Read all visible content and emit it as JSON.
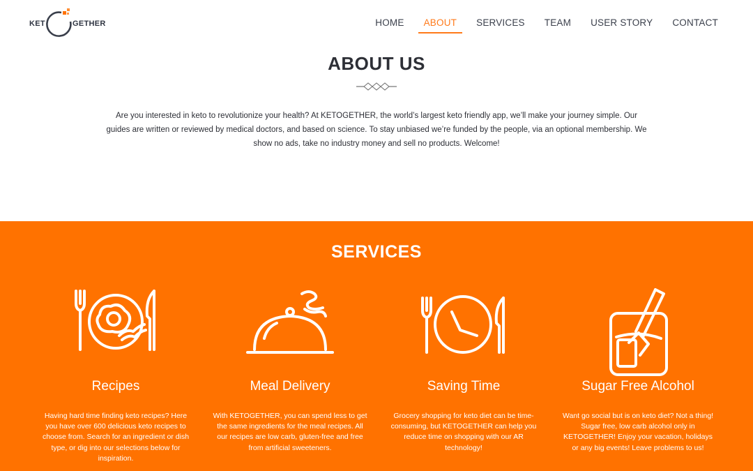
{
  "logo": {
    "left": "KET",
    "right": "GETHER"
  },
  "nav": {
    "items": [
      {
        "label": "HOME"
      },
      {
        "label": "ABOUT"
      },
      {
        "label": "SERVICES"
      },
      {
        "label": "TEAM"
      },
      {
        "label": "USER STORY"
      },
      {
        "label": "CONTACT"
      }
    ],
    "active": "ABOUT"
  },
  "about": {
    "title": "ABOUT US",
    "text": "Are you interested in keto to revolutionize your health? At KETOGETHER, the world’s largest keto friendly app, we’ll make your journey simple. Our guides are written or reviewed by medical doctors, and based on science. To stay unbiased we’re funded by the people, via an optional membership. We show no ads, take no industry money and sell no products. Welcome!"
  },
  "services": {
    "title": "SERVICES",
    "cards": [
      {
        "title": "Recipes",
        "icon": "plate-egg-icon",
        "text": "Having hard time finding keto recipes? Here you have over 600 delicious keto recipes to choose from. Search for an ingredient or dish type, or dig into our selections below for inspiration."
      },
      {
        "title": "Meal Delivery",
        "icon": "cloche-icon",
        "text": "With KETOGETHER, you can spend less to get the same ingredients for the meal recipes. All our recipes are low carb, gluten-free and free from artificial sweeteners."
      },
      {
        "title": "Saving Time",
        "icon": "plate-clock-icon",
        "text": "Grocery shopping for keto diet can be time-consuming, but KETOGETHER can help you reduce time on shopping with our AR technology!"
      },
      {
        "title": "Sugar Free Alcohol",
        "icon": "glass-straw-icon",
        "text": "Want go social but is on keto diet? Not a thing! Sugar free, low carb alcohol only in KETOGETHER! Enjoy your vacation, holidays or any big events! Leave problems to us!"
      }
    ]
  },
  "colors": {
    "accent": "#ff7200",
    "nav_active": "#ff7a1a",
    "text_dark": "#2d2f36"
  }
}
